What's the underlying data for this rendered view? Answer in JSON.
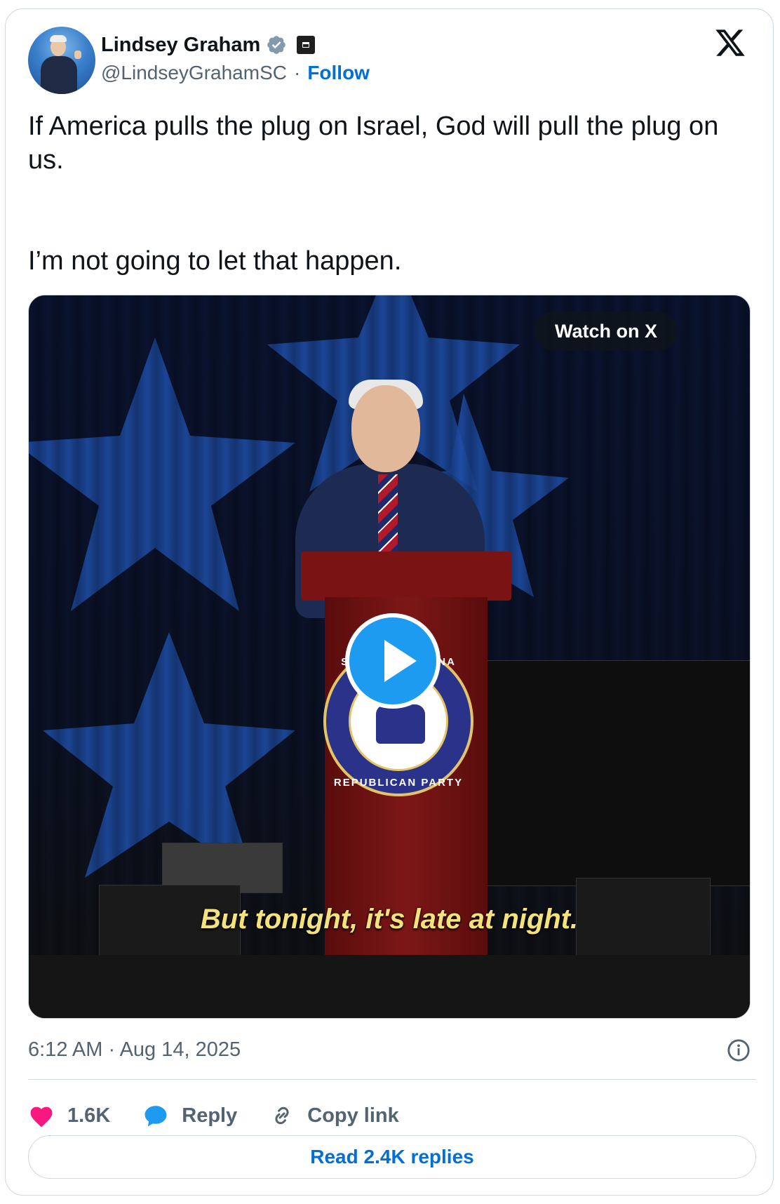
{
  "author": {
    "name": "Lindsey Graham",
    "handle": "@LindseyGrahamSC",
    "separator": "·",
    "follow_label": "Follow"
  },
  "tweet": {
    "line1": "If America pulls the plug on Israel, God will pull the plug on us.",
    "line2": "I’m not going to let that happen."
  },
  "media": {
    "watch_label": "Watch on X",
    "caption": "But tonight, it's late at night.",
    "seal_top": "SOUTH CAROLINA",
    "seal_bottom": "REPUBLICAN PARTY"
  },
  "meta": {
    "timestamp": "6:12 AM · Aug 14, 2025"
  },
  "actions": {
    "like_count": "1.6K",
    "reply_label": "Reply",
    "copy_label": "Copy link",
    "read_replies_label": "Read 2.4K replies"
  },
  "colors": {
    "like": "#f91880",
    "reply": "#1d9bf0",
    "link": "#006fd6",
    "muted": "#536471"
  },
  "icons": [
    "verified-badge-icon",
    "government-badge-icon",
    "x-logo-icon",
    "play-icon",
    "info-icon",
    "heart-icon",
    "reply-bubble-icon",
    "link-icon"
  ]
}
